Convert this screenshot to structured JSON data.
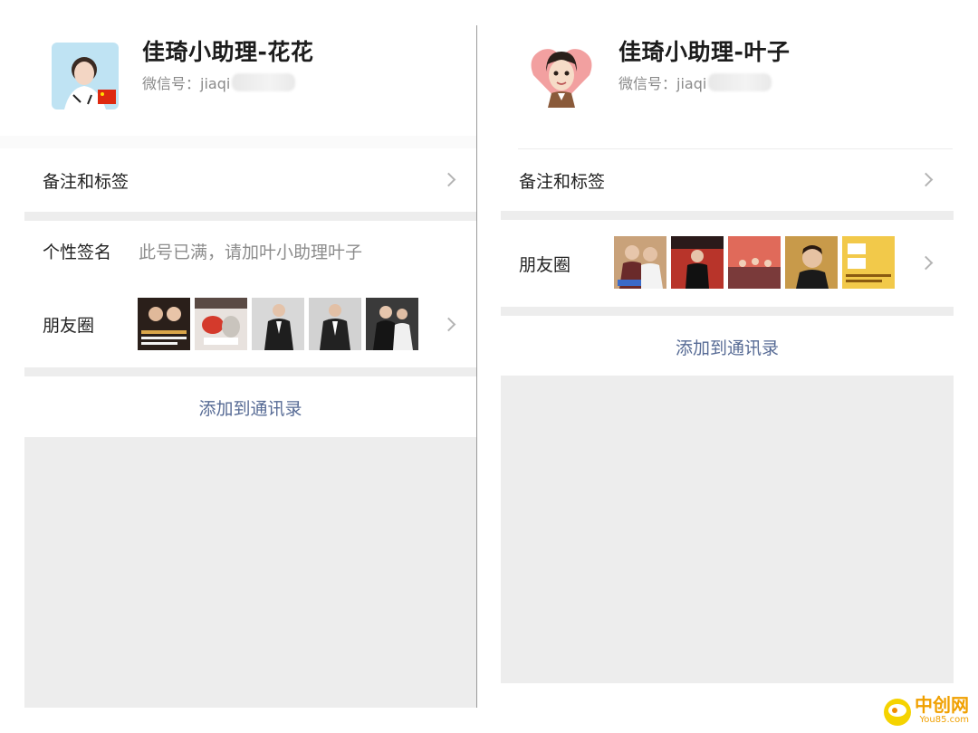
{
  "left": {
    "name": "佳琦小助理-花花",
    "wxid_prefix": "微信号：jiaqi",
    "remarks_label": "备注和标签",
    "signature_label": "个性签名",
    "signature_value": "此号已满，请加叶小助理叶子",
    "moments_label": "朋友圈",
    "add_contact_label": "添加到通讯录"
  },
  "right": {
    "name": "佳琦小助理-叶子",
    "wxid_prefix": "微信号：jiaqi",
    "remarks_label": "备注和标签",
    "moments_label": "朋友圈",
    "add_contact_label": "添加到通讯录"
  },
  "watermark": {
    "name": "中创网",
    "url": "You85.com"
  },
  "colors": {
    "link_blue": "#576b95",
    "separator_gray": "#ededed",
    "accent_yellow": "#f0a000"
  }
}
